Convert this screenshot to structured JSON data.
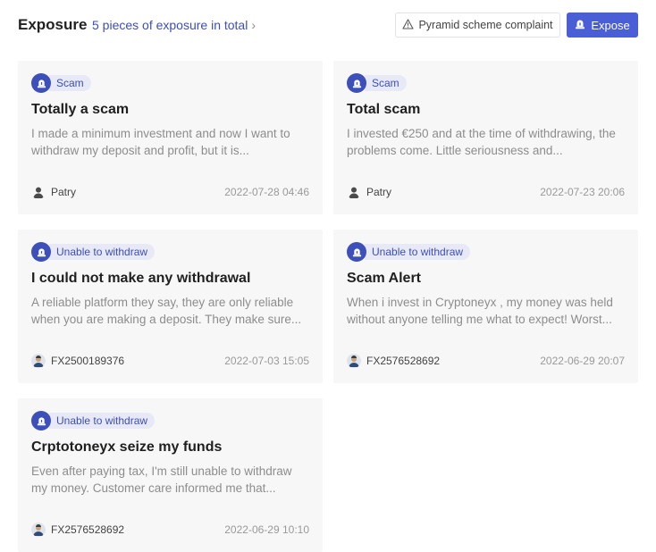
{
  "header": {
    "title": "Exposure",
    "count_text": "5 pieces of exposure in total",
    "complaint_button": "Pyramid scheme complaint",
    "expose_button": "Expose"
  },
  "colors": {
    "accent": "#4a5fd6",
    "tag_text": "#3d4fb8",
    "tag_bg": "#e7e9f6",
    "card_bg": "#f7f7f8"
  },
  "cards": [
    {
      "tag": "Scam",
      "title": "Totally a scam",
      "excerpt": "I made a minimum investment and now I want to withdraw my deposit and profit, but it is...",
      "author": "Patry",
      "date": "2022-07-28 04:46"
    },
    {
      "tag": "Scam",
      "title": "Total scam",
      "excerpt": "I invested €250 and at the time of withdrawing, the problems come. Little seriousness and...",
      "author": "Patry",
      "date": "2022-07-23 20:06"
    },
    {
      "tag": "Unable to withdraw",
      "title": "I could not make any withdrawal",
      "excerpt": "A reliable platform they say, they are only reliable when you are making a deposit. They make sure...",
      "author": "FX2500189376",
      "date": "2022-07-03 15:05"
    },
    {
      "tag": "Unable to withdraw",
      "title": "Scam Alert",
      "excerpt": "When i invest in Cryptoneyx , my money was held without anyone telling me what to expect! Worst...",
      "author": "FX2576528692",
      "date": "2022-06-29 20:07"
    },
    {
      "tag": "Unable to withdraw",
      "title": "Crptotoneyx seize my funds",
      "excerpt": "Even after paying tax, I'm still unable to withdraw my money. Customer care informed me that...",
      "author": "FX2576528692",
      "date": "2022-06-29 10:10"
    }
  ]
}
